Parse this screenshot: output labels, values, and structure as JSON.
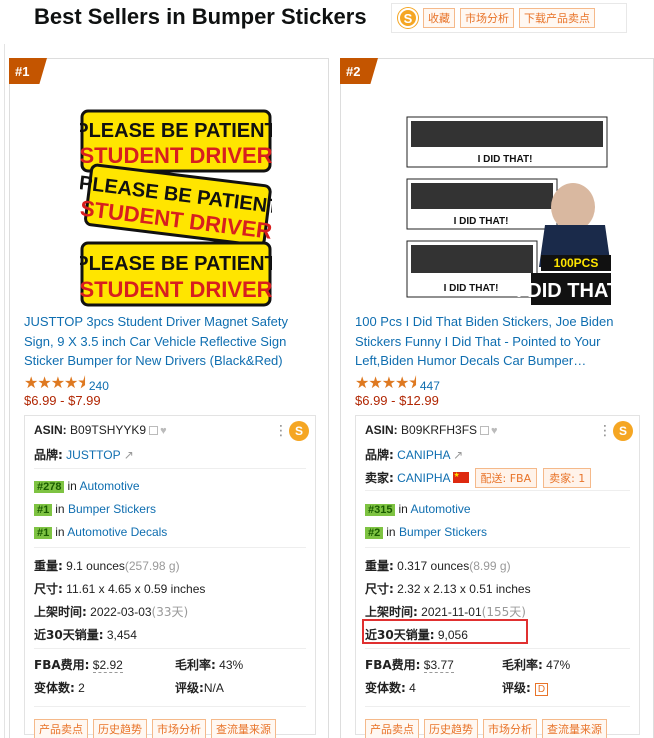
{
  "header": {
    "title": "Best Sellers in Bumper Stickers",
    "logo": "S",
    "tools": [
      "收藏",
      "市场分析",
      "下载产品卖点"
    ]
  },
  "products": [
    {
      "rank": "#1",
      "title": "JUSTTOP 3pcs Student Driver Magnet Safety Sign, 9 X 3.5 inch Car Vehicle Reflective Sign Sticker Bumper for New Drivers (Black&Red)",
      "image_text": {
        "line1": "PLEASE BE PATIENT",
        "line2": "STUDENT DRIVER"
      },
      "rating_stars": 4.5,
      "review_count": "240",
      "price": "$6.99 - $7.99",
      "asin_label": "ASIN:",
      "asin": "B09TSHYYK9",
      "brand_label": "品牌:",
      "brand": "JUSTTOP",
      "ranks": [
        {
          "rank": "#278",
          "in": "in",
          "category": "Automotive"
        },
        {
          "rank": "#1",
          "in": "in",
          "category": "Bumper Stickers"
        },
        {
          "rank": "#1",
          "in": "in",
          "category": "Automotive Decals"
        }
      ],
      "weight_label": "重量:",
      "weight": "9.1 ounces",
      "weight_g": "(257.98 g)",
      "size_label": "尺寸:",
      "size": "11.61 x 4.65 x 0.59 inches",
      "listed_label": "上架时间:",
      "listed": "2022-03-03",
      "listed_days": "(33天)",
      "sales_label": "近30天销量:",
      "sales": "3,454",
      "fba_label": "FBA费用:",
      "fba": "$2.92",
      "margin_label": "毛利率:",
      "margin": "43%",
      "variants_label": "变体数:",
      "variants": "2",
      "grade_label": "评级:",
      "grade": "N/A",
      "buttons": [
        "产品卖点",
        "历史趋势",
        "市场分析",
        "查流量来源"
      ]
    },
    {
      "rank": "#2",
      "title": "100 Pcs I Did That Biden Stickers, Joe Biden Stickers Funny I Did That - Pointed to Your Left,Biden Humor Decals Car Bumper…",
      "image_text": {
        "sticker": "I DID THAT!",
        "badge": "100PCS",
        "big": "I DID THAT!"
      },
      "rating_stars": 4.5,
      "review_count": "447",
      "price": "$6.99 - $12.99",
      "asin_label": "ASIN:",
      "asin": "B09KRFH3FS",
      "brand_label": "品牌:",
      "brand": "CANIPHA",
      "seller_label": "卖家:",
      "seller": "CANIPHA",
      "fulfillment": "配送: FBA",
      "seller_count": "卖家: 1",
      "ranks": [
        {
          "rank": "#315",
          "in": "in",
          "category": "Automotive"
        },
        {
          "rank": "#2",
          "in": "in",
          "category": "Bumper Stickers"
        }
      ],
      "weight_label": "重量:",
      "weight": "0.317 ounces",
      "weight_g": "(8.99 g)",
      "size_label": "尺寸:",
      "size": "2.32 x 2.13 x 0.51 inches",
      "listed_label": "上架时间:",
      "listed": "2021-11-01",
      "listed_days": "(155天)",
      "sales_label": "近30天销量:",
      "sales": "9,056",
      "fba_label": "FBA费用:",
      "fba": "$3.77",
      "margin_label": "毛利率:",
      "margin": "47%",
      "variants_label": "变体数:",
      "variants": "4",
      "grade_label": "评级:",
      "grade": "D",
      "buttons": [
        "产品卖点",
        "历史趋势",
        "市场分析",
        "查流量来源"
      ]
    }
  ],
  "colors": {
    "rank_badge": "#c45500",
    "link": "#0f6eb0",
    "price": "#b12704",
    "star": "#de7921",
    "highlight": "#e03030",
    "rank_tag": "#7ec342"
  }
}
